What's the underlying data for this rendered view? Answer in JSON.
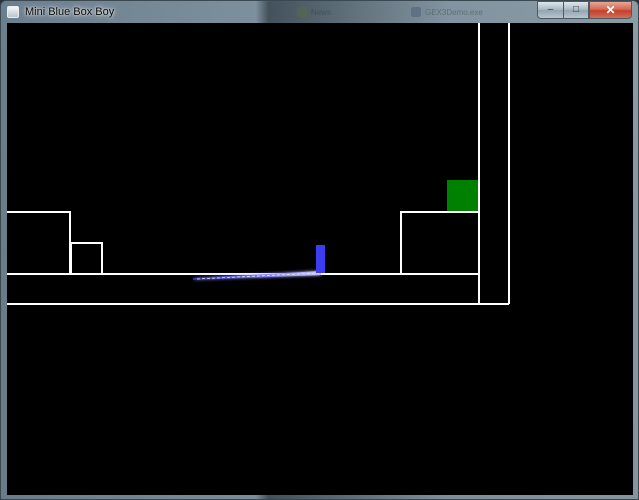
{
  "window": {
    "title": "Mini Blue Box Boy"
  },
  "background_ghost_items": [
    "News",
    "GEX3Demo.exe"
  ],
  "controls": {
    "minimize_glyph": "‒",
    "maximize_glyph": "□",
    "close_glyph": "✕"
  },
  "colors": {
    "level_lines": "#ffffff",
    "player": "#3c3cf0",
    "goal": "#008000",
    "background": "#000000",
    "trail": "#6f6fff"
  }
}
